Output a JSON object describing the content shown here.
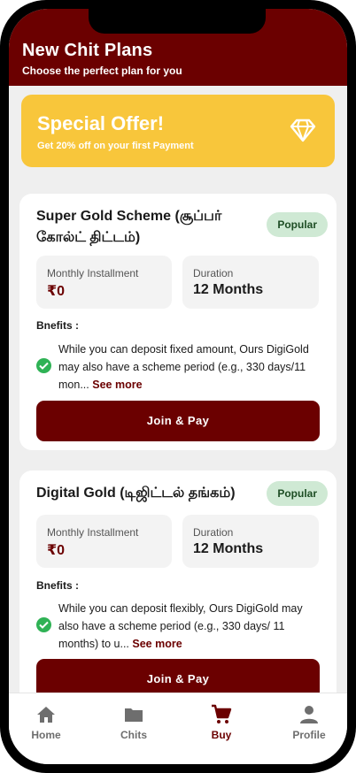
{
  "header": {
    "title": "New Chit Plans",
    "subtitle": "Choose the perfect plan for you"
  },
  "offer": {
    "title": "Special Offer!",
    "subtitle": "Get 20% off on your first Payment",
    "icon": "diamond-icon"
  },
  "plans": [
    {
      "title": "Super Gold Scheme (சூப்பர் கோல்ட் திட்டம்)",
      "badge": "Popular",
      "installment_label": "Monthly Installment",
      "installment_value": "₹0",
      "duration_label": "Duration",
      "duration_value": "12 Months",
      "benefits_label": "Bnefits :",
      "benefit_text": "While you can deposit fixed amount, Ours DigiGold may also have a scheme period (e.g., 330 days/11 mon...",
      "see_more": "See more",
      "button_label": "Join & Pay"
    },
    {
      "title": "Digital Gold (டிஜிட்டல் தங்கம்)",
      "badge": "Popular",
      "installment_label": "Monthly Installment",
      "installment_value": "₹0",
      "duration_label": "Duration",
      "duration_value": "12 Months",
      "benefits_label": "Bnefits :",
      "benefit_text": "While you can deposit flexibly, Ours DigiGold may also have a scheme period (e.g., 330 days/ 11 months) to u...",
      "see_more": "See more",
      "button_label": "Join & Pay"
    }
  ],
  "nav": {
    "items": [
      {
        "label": "Home",
        "icon": "home-icon"
      },
      {
        "label": "Chits",
        "icon": "folder-icon"
      },
      {
        "label": "Buy",
        "icon": "cart-icon",
        "active": true
      },
      {
        "label": "Profile",
        "icon": "person-icon"
      }
    ]
  },
  "colors": {
    "brand": "#6b0000",
    "offer": "#f8c63b",
    "badge_bg": "#cfe9d4",
    "check": "#2fb255"
  }
}
